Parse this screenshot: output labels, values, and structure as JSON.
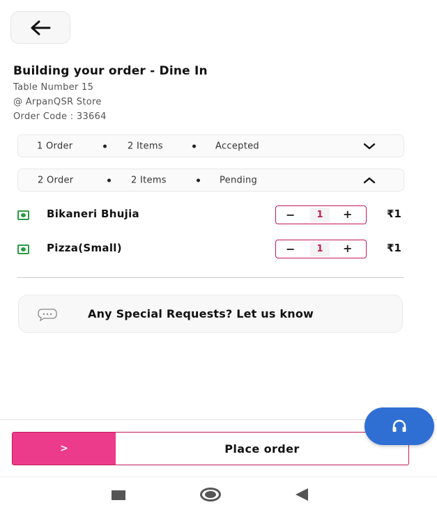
{
  "header": {
    "back_icon": "arrow-left-icon",
    "title": "Building your order - Dine In",
    "table_number": "Table Number 15",
    "store": "@ ArpanQSR Store",
    "order_code": "Order Code : 33664"
  },
  "orders": [
    {
      "order": "1 Order",
      "items": "2 Items",
      "status": "Accepted",
      "chevron": "chevron-down-icon"
    },
    {
      "order": "2 Order",
      "items": "2 Items",
      "status": "Pending",
      "chevron": "chevron-up-icon"
    }
  ],
  "cart_items": [
    {
      "name": "Bikaneri Bhujia",
      "qty": "1",
      "minus": "−",
      "plus": "+",
      "price": "₹1"
    },
    {
      "name": "Pizza(Small)",
      "qty": "1",
      "minus": "−",
      "plus": "+",
      "price": "₹1"
    }
  ],
  "special_request": {
    "icon": "chat-bubble-icon",
    "label": "Any Special Requests? Let us know"
  },
  "place_order": {
    "arrow_label": ">",
    "label": "Place order"
  },
  "support": {
    "icon": "headset-icon"
  },
  "colors": {
    "accent": "#c2185b",
    "button_pink": "#ec3b8a",
    "fab_blue": "#2f6fd4",
    "veg_green": "#2c9a45"
  }
}
